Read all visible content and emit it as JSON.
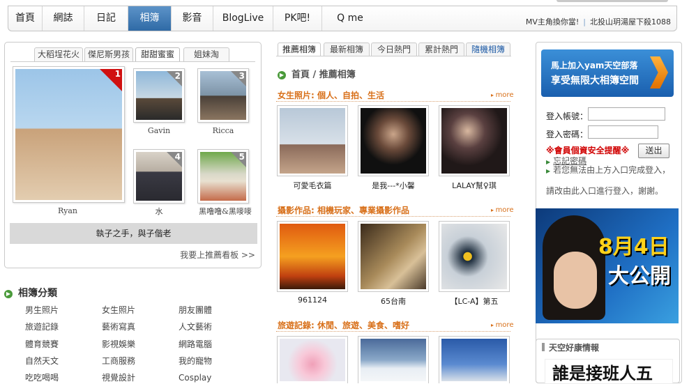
{
  "nav": {
    "items": [
      "首頁",
      "網誌",
      "日記",
      "相簿",
      "影音",
      "BlogLive",
      "PK吧!",
      "Q me"
    ],
    "active_index": 3,
    "right_links": [
      "MV主角換你當!",
      "北投山玥湯屋下殺1088"
    ]
  },
  "left": {
    "tabs": [
      "大稻埕花火",
      "傑尼斯男孩",
      "甜甜蜜蜜",
      "姐妹淘"
    ],
    "active_tab": 2,
    "featured": [
      {
        "rank": "1",
        "name": "Ryan"
      },
      {
        "rank": "2",
        "name": "Gavin"
      },
      {
        "rank": "3",
        "name": "Ricca"
      },
      {
        "rank": "4",
        "name": "水"
      },
      {
        "rank": "5",
        "name": "黑噜噜&黑嘜嘜"
      }
    ],
    "quote": "執子之手，與子偕老",
    "upload_link": "我要上推薦看板 >>"
  },
  "categories": {
    "title": "相簿分類",
    "items": [
      "男生照片",
      "女生照片",
      "朋友團體",
      "旅遊記錄",
      "藝術寫真",
      "人文藝術",
      "體育競賽",
      "影視娛樂",
      "網路電腦",
      "自然天文",
      "工商服務",
      "我的寵物",
      "吃吃喝喝",
      "視覺設計",
      "Cosplay"
    ]
  },
  "center": {
    "tabs": [
      "推薦相簿",
      "最新相簿",
      "今日熱門",
      "累計熱門",
      "隨機相簿"
    ],
    "active_tab": 0,
    "breadcrumb": "首頁 / 推薦相簿",
    "more_label": "more",
    "sections": [
      {
        "title": "女生照片: 個人、自拍、生活",
        "items": [
          "可愛毛衣篇",
          "是我---*小馨",
          "LALAY幫♀琪"
        ]
      },
      {
        "title": "攝影作品: 相機玩家、專業攝影作品",
        "items": [
          "961124",
          "65台南",
          "【LC-A】第五"
        ]
      },
      {
        "title": "旅遊記錄: 休閒、旅遊、美食、嗜好",
        "items": [
          "",
          "",
          ""
        ]
      }
    ]
  },
  "right": {
    "join_line1": "馬上加入yam天空部落",
    "join_line2": "享受無限大相簿空間",
    "account_label": "登入帳號：",
    "password_label": "登入密碼：",
    "security_warning": "※會員個資安全提醒※",
    "submit_label": "送出",
    "forgot_link": "忘記密碼",
    "help_text_1": "若您無法由上方入口完成登入，",
    "help_text_2": "請改由此入口進行登入，謝謝。",
    "ad_line1": "8月4日",
    "ad_line2": "大公開",
    "news_title": "天空好康情報",
    "news_text": "誰是接班人五"
  }
}
